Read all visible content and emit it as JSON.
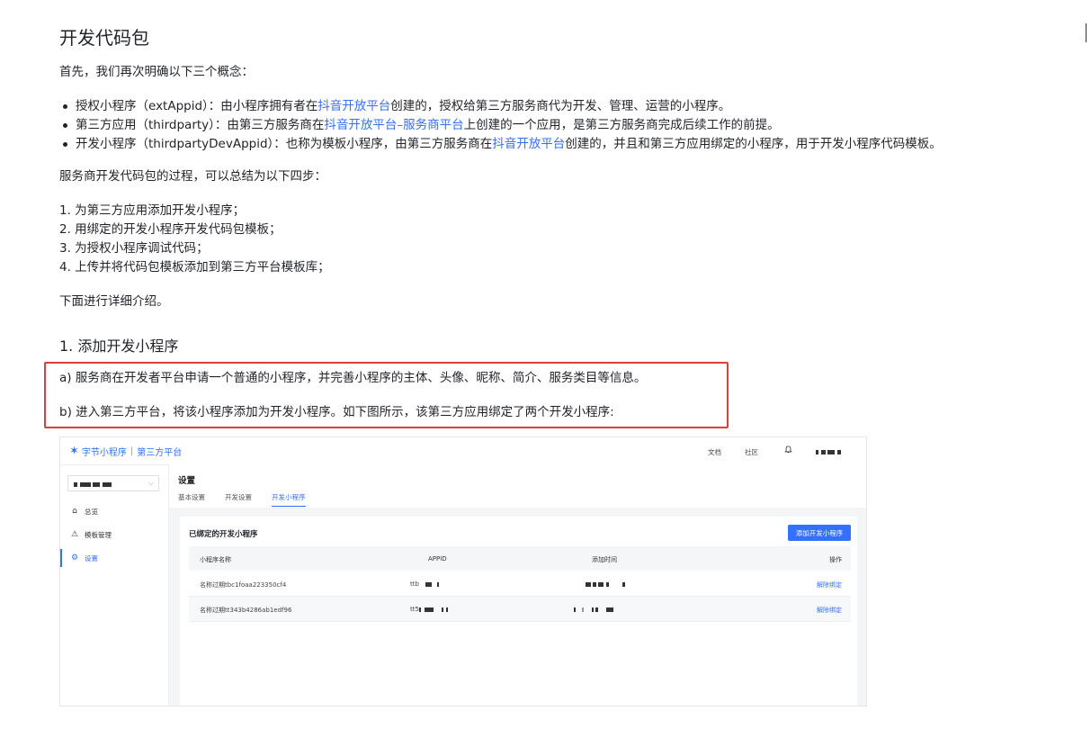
{
  "doc": {
    "title": "开发代码包",
    "intro": "首先，我们再次明确以下三个概念：",
    "concepts": [
      {
        "before": "授权小程序（extAppid）：由小程序拥有者在",
        "link": "抖音开放平台",
        "after": "创建的，授权给第三方服务商代为开发、管理、运营的小程序。"
      },
      {
        "before": "第三方应用（thirdparty）：由第三方服务商在",
        "link": "抖音开放平台–服务商平台",
        "after": "上创建的一个应用，是第三方服务商完成后续工作的前提。"
      },
      {
        "before": "开发小程序（thirdpartyDevAppid）：也称为模板小程序，由第三方服务商在",
        "link": "抖音开放平台",
        "after": "创建的，并且和第三方应用绑定的小程序，用于开发小程序代码模板。"
      }
    ],
    "process_intro": "服务商开发代码包的过程，可以总结为以下四步：",
    "steps": [
      "1. 为第三方应用添加开发小程序；",
      "2. 用绑定的开发小程序开发代码包模板；",
      "3. 为授权小程序调试代码；",
      "4. 上传并将代码包模板添加到第三方平台模板库；"
    ],
    "detail_intro": "下面进行详细介绍。",
    "section_title": "1. 添加开发小程序",
    "step_a": "a) 服务商在开发者平台申请一个普通的小程序，并完善小程序的主体、头像、昵称、简介、服务类目等信息。",
    "step_b": "b) 进入第三方平台，将该小程序添加为开发小程序。如下图所示，该第三方应用绑定了两个开发小程序:"
  },
  "screenshot": {
    "brand": "字节小程序",
    "brand_sub": "第三方平台",
    "nav": [
      "文档",
      "社区"
    ],
    "menu": [
      {
        "label": "总览",
        "icon": "home-icon"
      },
      {
        "label": "模板管理",
        "icon": "warning-triangle-icon"
      },
      {
        "label": "设置",
        "icon": "gear-icon"
      }
    ],
    "page_title": "设置",
    "tabs": [
      "基本设置",
      "开发设置",
      "开发小程序"
    ],
    "active_tab": "开发小程序",
    "card_title": "已绑定的开发小程序",
    "add_button": "添加开发小程序",
    "columns": [
      "小程序名称",
      "APPID",
      "添加时间",
      "操作"
    ],
    "rows": [
      {
        "name": "名称过期tbc1foaa223350cf4",
        "appid_prefix": "ttb",
        "op": "解除绑定"
      },
      {
        "name": "名称过期tt343b4286ab1edf96",
        "appid_prefix": "tt5",
        "op": "解除绑定"
      }
    ],
    "colors": {
      "accent": "#3370ff",
      "highlight_border": "#e03c3c"
    }
  }
}
